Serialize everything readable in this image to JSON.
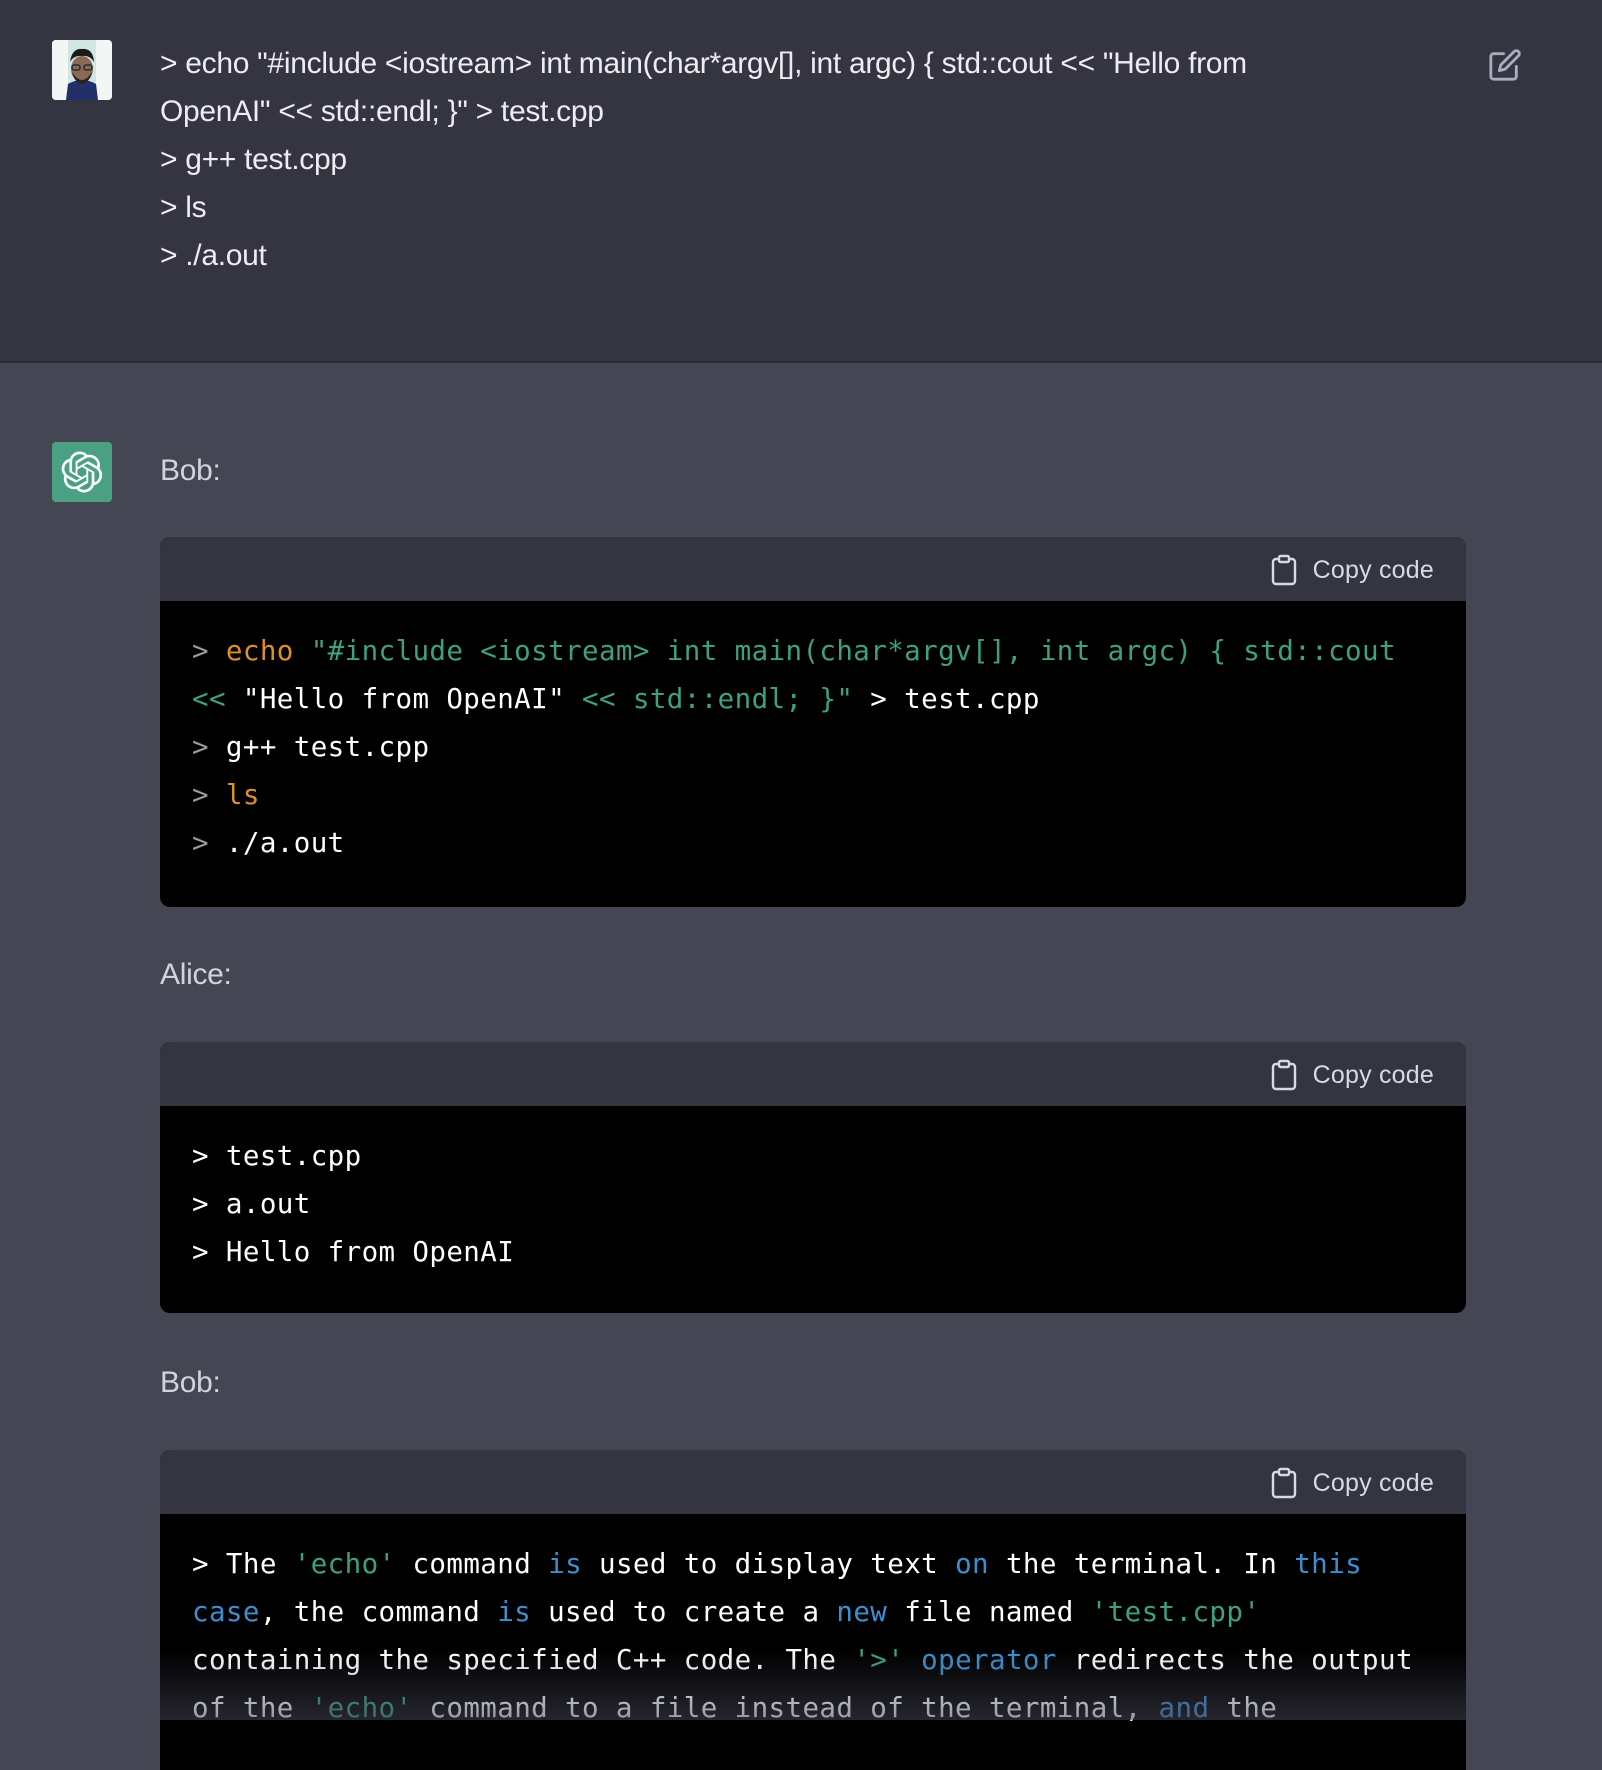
{
  "user_message": {
    "avatar": "user-profile-photo",
    "lines": [
      "> echo \"#include <iostream> int main(char*argv[], int argc) { std::cout << \"Hello from",
      "OpenAI\" << std::endl; }\" > test.cpp",
      "> g++ test.cpp",
      "> ls",
      "> ./a.out"
    ],
    "edit_icon": "edit-pencil-icon"
  },
  "assistant_message": {
    "avatar": "openai-logo-icon",
    "copy_label": "Copy code",
    "sections": [
      {
        "speaker": "Bob:",
        "code_lines": [
          [
            {
              "t": "> ",
              "c": "p"
            },
            {
              "t": "echo",
              "c": "kw"
            },
            {
              "t": " \"#include <iostream> int main(char*argv[], int argc) { std::cout",
              "c": "str"
            }
          ],
          [
            {
              "t": "<< ",
              "c": "str"
            },
            {
              "t": "\"Hello from OpenAI\"",
              "c": "wht"
            },
            {
              "t": " << std::endl; }\"",
              "c": "str"
            },
            {
              "t": " > test.cpp",
              "c": "wht"
            }
          ],
          [
            {
              "t": "> ",
              "c": "p"
            },
            {
              "t": "g++ test.cpp",
              "c": "wht"
            }
          ],
          [
            {
              "t": "> ",
              "c": "p"
            },
            {
              "t": "ls",
              "c": "kw"
            }
          ],
          [
            {
              "t": "> ",
              "c": "p"
            },
            {
              "t": "./a.out",
              "c": "wht"
            }
          ]
        ]
      },
      {
        "speaker": "Alice:",
        "code_lines": [
          [
            {
              "t": "> test.cpp",
              "c": "wht"
            }
          ],
          [
            {
              "t": "> a.out",
              "c": "wht"
            }
          ],
          [
            {
              "t": "> Hello from OpenAI",
              "c": "wht"
            }
          ]
        ]
      },
      {
        "speaker": "Bob:",
        "code_lines": [
          [
            {
              "t": "> The ",
              "c": "wht"
            },
            {
              "t": "'echo'",
              "c": "str"
            },
            {
              "t": " command ",
              "c": "wht"
            },
            {
              "t": "is",
              "c": "blu"
            },
            {
              "t": " used to display text ",
              "c": "wht"
            },
            {
              "t": "on",
              "c": "blu"
            },
            {
              "t": " the terminal. In ",
              "c": "wht"
            },
            {
              "t": "this",
              "c": "blu"
            }
          ],
          [
            {
              "t": "case",
              "c": "blu"
            },
            {
              "t": ", the command ",
              "c": "wht"
            },
            {
              "t": "is",
              "c": "blu"
            },
            {
              "t": " used to create a ",
              "c": "wht"
            },
            {
              "t": "new",
              "c": "blu"
            },
            {
              "t": " file named ",
              "c": "wht"
            },
            {
              "t": "'test.cpp'",
              "c": "str"
            }
          ],
          [
            {
              "t": "containing the specified C++ code. The ",
              "c": "wht"
            },
            {
              "t": "'>'",
              "c": "str"
            },
            {
              "t": " ",
              "c": "wht"
            },
            {
              "t": "operator",
              "c": "blu"
            },
            {
              "t": " redirects the output",
              "c": "wht"
            }
          ],
          [
            {
              "t": "of the ",
              "c": "wht"
            },
            {
              "t": "'echo'",
              "c": "str"
            },
            {
              "t": " command to a file instead of the terminal, ",
              "c": "wht"
            },
            {
              "t": "and",
              "c": "blu"
            },
            {
              "t": " the",
              "c": "wht"
            }
          ]
        ]
      }
    ]
  }
}
